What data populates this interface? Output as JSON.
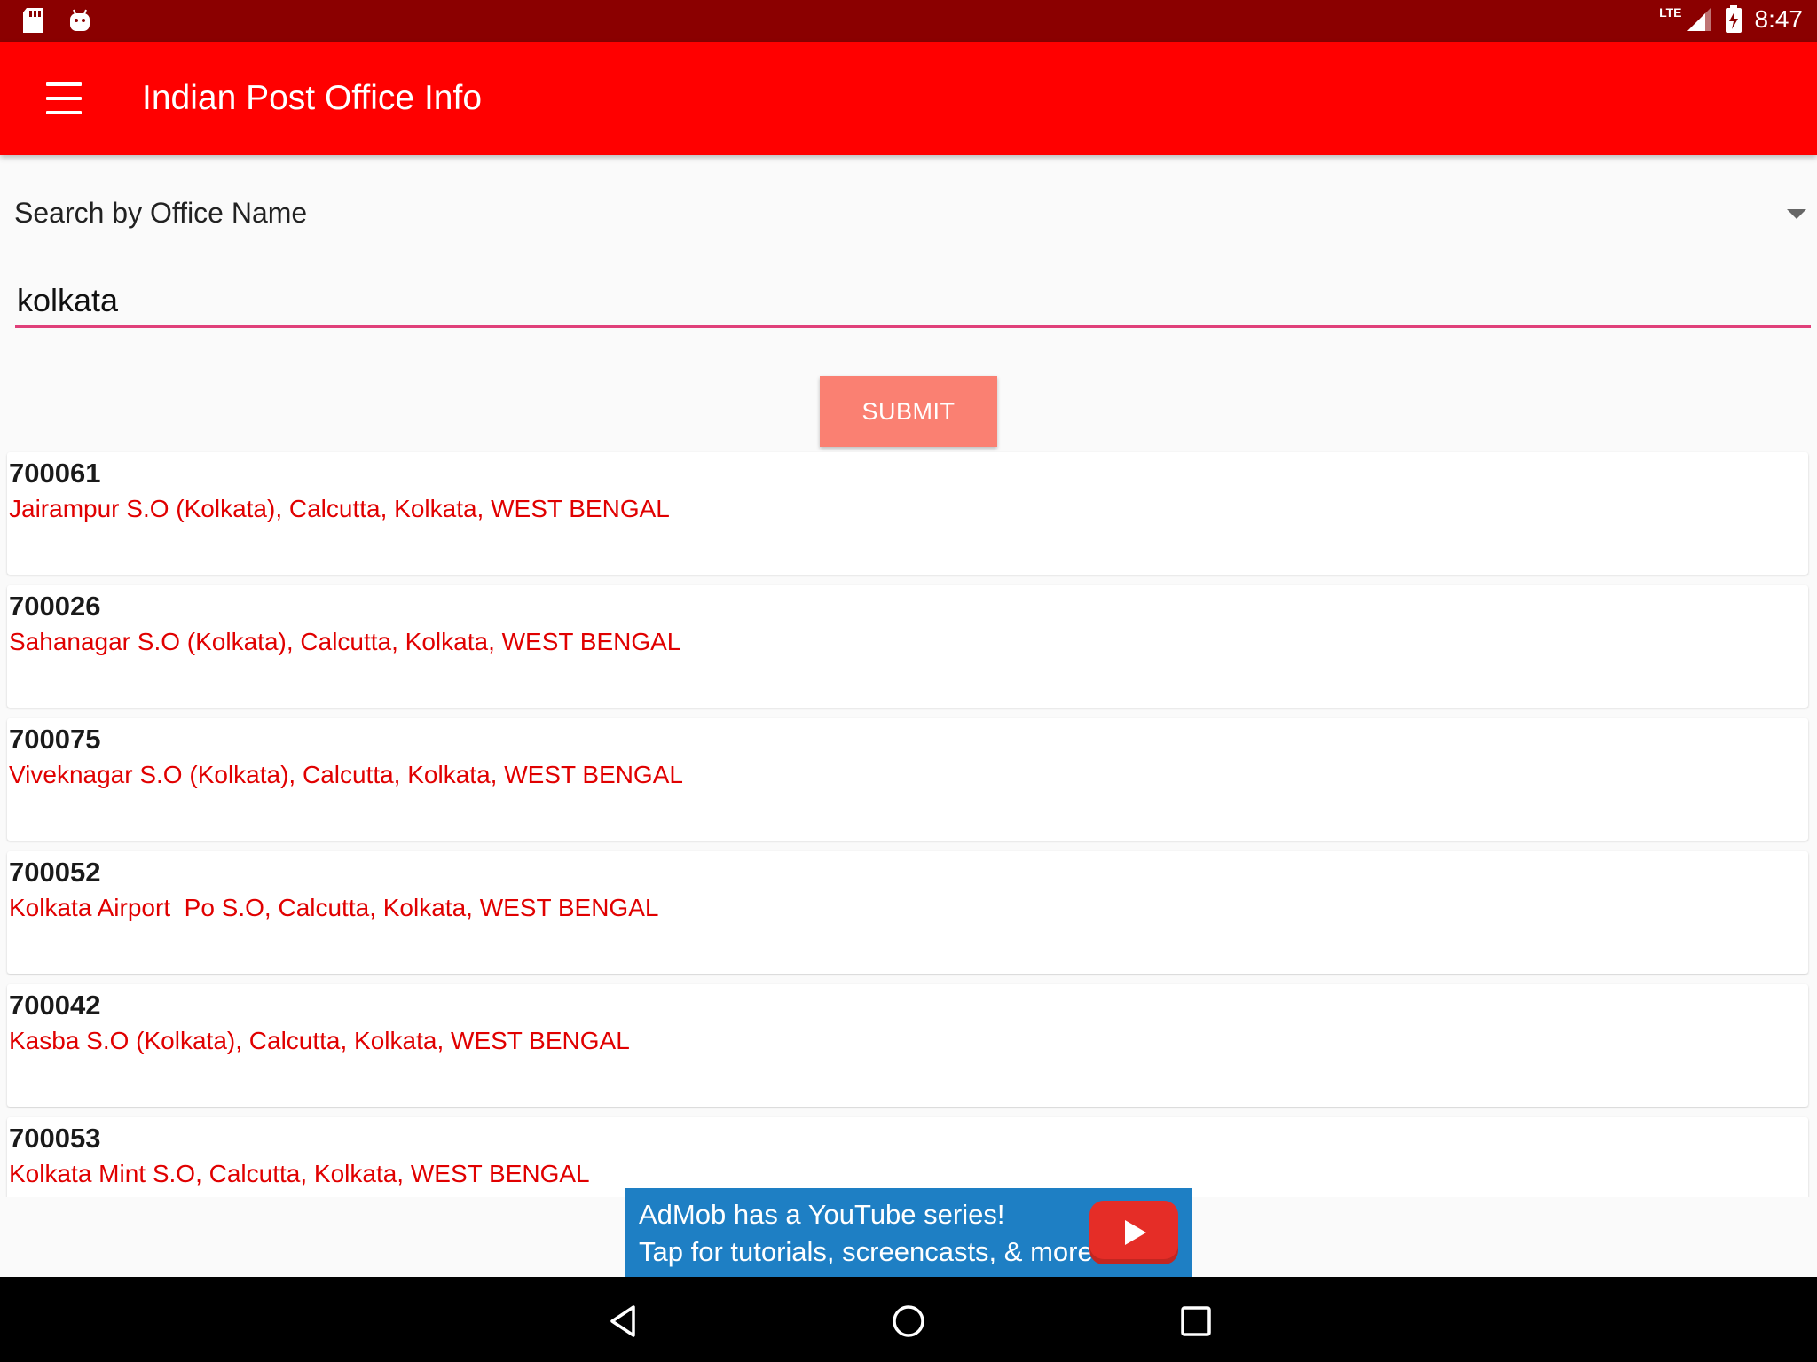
{
  "status_bar": {
    "time": "8:47",
    "network": "LTE",
    "icons": [
      "sd-card-icon",
      "android-debug-icon",
      "signal-icon",
      "battery-charging-icon"
    ]
  },
  "app_bar": {
    "title": "Indian Post Office Info",
    "menu_icon": "hamburger-menu-icon"
  },
  "search": {
    "type_label": "Search by Office Name",
    "query": "kolkata",
    "submit_label": "SUBMIT"
  },
  "results": [
    {
      "pincode": "700061",
      "address": "Jairampur S.O (Kolkata), Calcutta, Kolkata, WEST BENGAL"
    },
    {
      "pincode": "700026",
      "address": "Sahanagar S.O (Kolkata), Calcutta, Kolkata, WEST BENGAL"
    },
    {
      "pincode": "700075",
      "address": "Viveknagar S.O (Kolkata), Calcutta, Kolkata, WEST BENGAL"
    },
    {
      "pincode": "700052",
      "address": "Kolkata Airport  Po S.O, Calcutta, Kolkata, WEST BENGAL"
    },
    {
      "pincode": "700042",
      "address": "Kasba S.O (Kolkata), Calcutta, Kolkata, WEST BENGAL"
    },
    {
      "pincode": "700053",
      "address": "Kolkata Mint S.O, Calcutta, Kolkata, WEST BENGAL"
    }
  ],
  "ad": {
    "line1": "AdMob has a YouTube series!",
    "line2": "Tap for tutorials, screencasts, & more.",
    "icon": "youtube-play-icon"
  },
  "colors": {
    "status_bar": "#8b0000",
    "app_bar": "#ff0000",
    "accent_underline": "#e0407a",
    "submit": "#fa8072",
    "address_text": "#e00000",
    "ad_background": "#1e7fc4"
  },
  "nav_bar": {
    "icons": [
      "back-icon",
      "home-icon",
      "recents-icon"
    ]
  }
}
